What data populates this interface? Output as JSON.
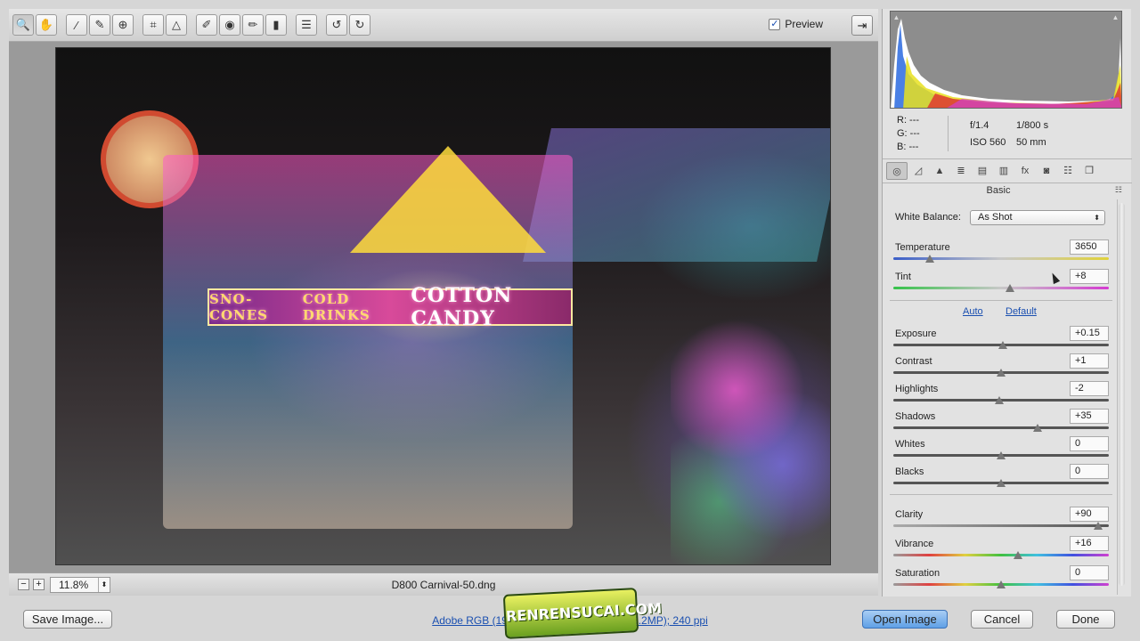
{
  "toolbar": {
    "tools": [
      {
        "name": "zoom-tool",
        "glyph": "🔍"
      },
      {
        "name": "hand-tool",
        "glyph": "✋"
      },
      {
        "name": "white-balance-tool",
        "glyph": "⁄"
      },
      {
        "name": "color-sampler-tool",
        "glyph": "✎"
      },
      {
        "name": "targeted-adjustment-tool",
        "glyph": "⊕"
      },
      {
        "name": "crop-tool",
        "glyph": "⌗"
      },
      {
        "name": "straighten-tool",
        "glyph": "△"
      },
      {
        "name": "spot-removal-tool",
        "glyph": "✐"
      },
      {
        "name": "red-eye-tool",
        "glyph": "◉"
      },
      {
        "name": "adjustment-brush-tool",
        "glyph": "✏"
      },
      {
        "name": "graduated-filter-tool",
        "glyph": "▮"
      },
      {
        "name": "preferences-tool",
        "glyph": "☰"
      },
      {
        "name": "rotate-ccw-tool",
        "glyph": "↺"
      },
      {
        "name": "rotate-cw-tool",
        "glyph": "↻"
      }
    ],
    "preview_label": "Preview",
    "preview_checked": "✓",
    "fullscreen_glyph": "⇥"
  },
  "photo": {
    "sign_left": "SNO-CONES",
    "sign_mid": "COLD DRINKS",
    "sign_main": "COTTON CANDY"
  },
  "status": {
    "zoom_out": "−",
    "zoom_in": "+",
    "zoom_value": "11.8%",
    "zoom_arrow": "⬍",
    "filename": "D800 Carnival-50.dng"
  },
  "readout": {
    "r": "R:  ---",
    "g": "G:  ---",
    "b": "B:  ---",
    "aperture": "f/1.4",
    "shutter": "1/800 s",
    "iso": "ISO 560",
    "focal": "50 mm"
  },
  "panel": {
    "tabs": [
      "◎",
      "◿",
      "▲",
      "≣",
      "▤",
      "▥",
      "fx",
      "◙",
      "☷",
      "❐"
    ],
    "section_title": "Basic",
    "menu_glyph": "☷",
    "wb_label": "White Balance:",
    "wb_value": "As Shot",
    "wb_arrow": "⬍",
    "auto_label": "Auto",
    "default_label": "Default",
    "sliders": {
      "temperature": {
        "label": "Temperature",
        "value": "3650",
        "position": 0.17
      },
      "tint": {
        "label": "Tint",
        "value": "+8",
        "position": 0.54
      },
      "exposure": {
        "label": "Exposure",
        "value": "+0.15",
        "position": 0.51
      },
      "contrast": {
        "label": "Contrast",
        "value": "+1",
        "position": 0.5
      },
      "highlights": {
        "label": "Highlights",
        "value": "-2",
        "position": 0.49
      },
      "shadows": {
        "label": "Shadows",
        "value": "+35",
        "position": 0.67
      },
      "whites": {
        "label": "Whites",
        "value": "0",
        "position": 0.5
      },
      "blacks": {
        "label": "Blacks",
        "value": "0",
        "position": 0.5
      },
      "clarity": {
        "label": "Clarity",
        "value": "+90",
        "position": 0.95
      },
      "vibrance": {
        "label": "Vibrance",
        "value": "+16",
        "position": 0.58
      },
      "saturation": {
        "label": "Saturation",
        "value": "0",
        "position": 0.5
      }
    }
  },
  "footer": {
    "save_label": "Save Image...",
    "workflow_label": "Adobe RGB (1998); 8 bit; 7360 by 4912 (36.2MP); 240 ppi",
    "open_label": "Open Image",
    "cancel_label": "Cancel",
    "done_label": "Done",
    "watermark_text": "RENRENSUCAI.COM"
  },
  "colors": {
    "accent": "#1a4fb0",
    "primary_button": "#5fa0e6"
  }
}
